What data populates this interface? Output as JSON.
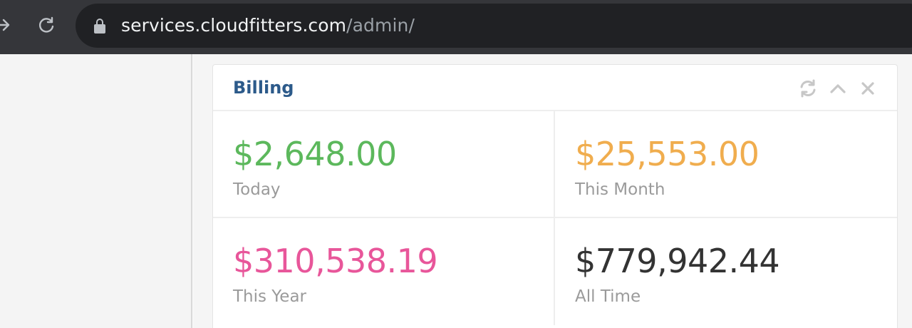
{
  "browser": {
    "url_host": "services.cloudfitters.com",
    "url_path": "/admin/",
    "icons": [
      "forward-icon",
      "reload-icon",
      "lock-icon"
    ]
  },
  "panel": {
    "title": "Billing",
    "tools": [
      "refresh-icon",
      "collapse-icon",
      "close-icon"
    ],
    "stats": [
      {
        "amount": "$2,648.00",
        "label": "Today",
        "color": "#5cb85c"
      },
      {
        "amount": "$25,553.00",
        "label": "This Month",
        "color": "#f0ad4e"
      },
      {
        "amount": "$310,538.19",
        "label": "This Year",
        "color": "#e8569a"
      },
      {
        "amount": "$779,942.44",
        "label": "All Time",
        "color": "#333333"
      }
    ]
  }
}
